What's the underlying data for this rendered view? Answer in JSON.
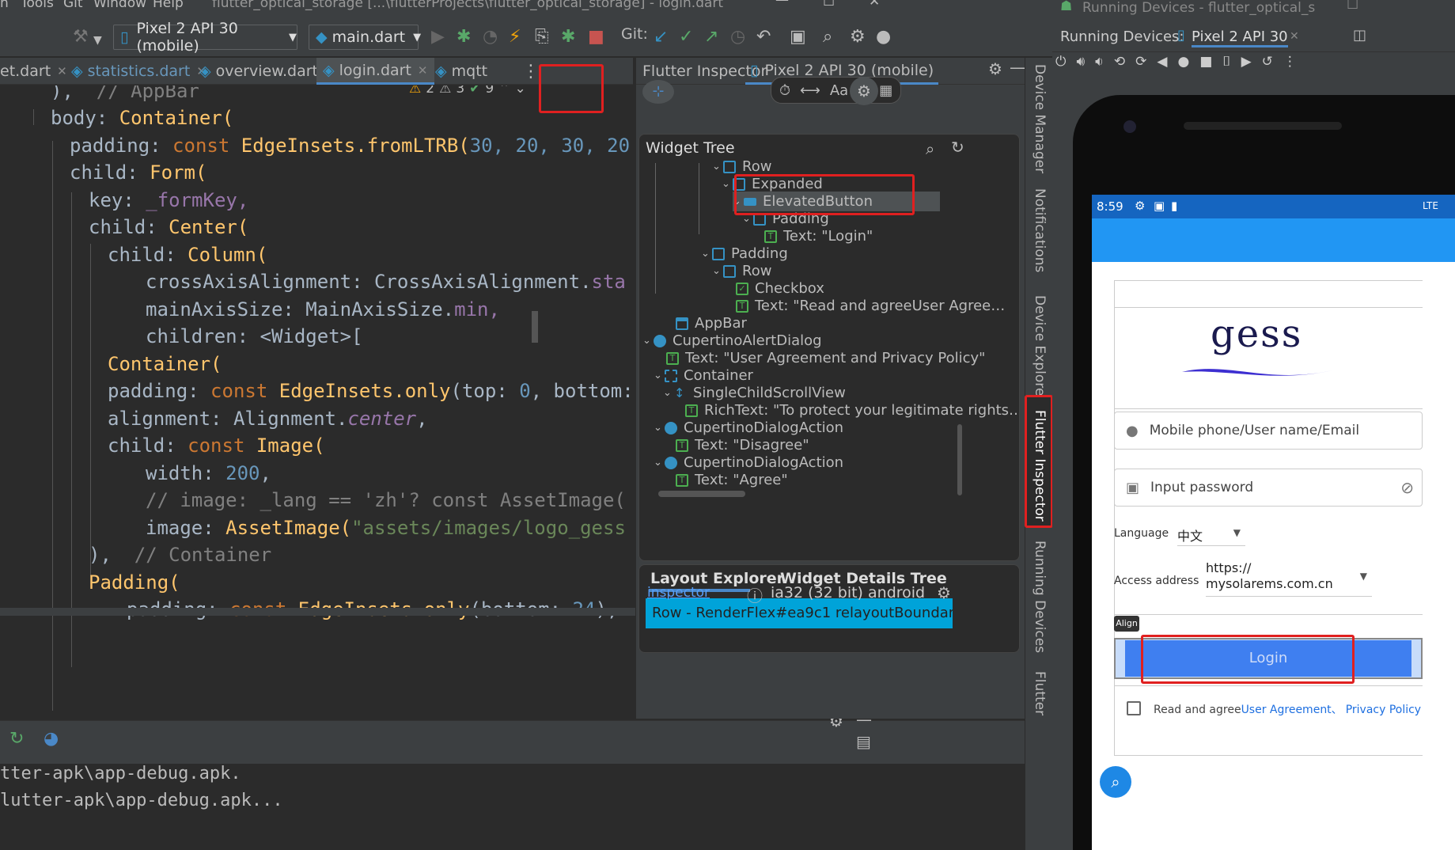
{
  "menu": {
    "items": [
      "n",
      "Tools",
      "Git",
      "Window",
      "Help"
    ],
    "title": "flutter_optical_storage [...\\flutterProjects\\flutter_optical_storage] - login.dart"
  },
  "toolbar": {
    "device": "Pixel 2 API 30 (mobile)",
    "config": "main.dart",
    "git": "Git:"
  },
  "tabs": [
    "et.dart",
    "statistics.dart",
    "overview.dart",
    "login.dart",
    "mqtt"
  ],
  "editor": {
    "warnings": {
      "w1": "2",
      "w2": "3",
      "ok": "9"
    },
    "lines": [
      [
        "),  ",
        "// AppBar"
      ],
      [
        "body: ",
        "Container("
      ],
      [
        "padding: ",
        "const ",
        "EdgeInsets.fromLTRB(",
        "30, 20, 30, 20"
      ],
      [
        "child: ",
        "Form("
      ],
      [
        "key: ",
        "_formKey,"
      ],
      [
        "child: ",
        "Center("
      ],
      [
        "child: ",
        "Column("
      ],
      [
        "crossAxisAlignment: CrossAxisAlignment.",
        "sta"
      ],
      [
        "mainAxisSize: MainAxisSize.",
        "min,"
      ],
      [
        "children: <Widget>["
      ],
      [
        "Container("
      ],
      [
        "padding: ",
        "const ",
        "EdgeInsets.only",
        "(top: ",
        "0",
        ", bottom:"
      ],
      [
        "alignment: Alignment.",
        "center",
        ","
      ],
      [
        "child: ",
        "const ",
        "Image("
      ],
      [
        "width: ",
        "200",
        ","
      ],
      [
        "// image: _lang == 'zh'? const AssetImage("
      ],
      [
        "image: ",
        "AssetImage(",
        "\"assets/images/logo_gess"
      ],
      [
        "),  ",
        "// Container"
      ],
      [
        "Padding("
      ],
      [
        "padding: ",
        "const ",
        "EdgeInsets.only",
        "(bottom: ",
        "24",
        "),"
      ]
    ]
  },
  "inspector": {
    "tab_inspector": "Flutter Inspector",
    "tab_device": "Pixel 2 API 30 (mobile)",
    "tree_title": "Widget Tree",
    "nodes": [
      "Row",
      "Expanded",
      "ElevatedButton",
      "Padding",
      "Text: \"Login\"",
      "Padding",
      "Row",
      "Checkbox",
      "Text: \"Read and agreeUser Agree…",
      "AppBar",
      "CupertinoAlertDialog",
      "Text: \"User Agreement and Privacy Policy\"",
      "Container",
      "SingleChildScrollView",
      "RichText: \"To protect your legitimate rights…",
      "CupertinoDialogAction",
      "Text: \"Disagree\"",
      "CupertinoDialogAction",
      "Text: \"Agree\""
    ],
    "layout_tab": "Layout Explorer",
    "details_tab": "Widget Details Tree",
    "render_row": "Row - RenderFlex#ea9c1 relayoutBoundary…",
    "footer_link": "inspector",
    "footer_info": "ia32 (32 bit) android"
  },
  "side_strip": {
    "device_manager": "Device Manager",
    "notifications": "Notifications",
    "device_explorer": "Device Explorer",
    "flutter_inspector": "Flutter Inspector",
    "running_devices": "Running Devices",
    "flutter": "Flutter"
  },
  "bottom": {
    "lines": [
      "tter-apk\\app-debug.apk.",
      "lutter-apk\\app-debug.apk..."
    ]
  },
  "running": {
    "title": "Running Devices - flutter_optical_s",
    "label": "Running Devices:",
    "device_tab": "Pixel 2 API 30"
  },
  "phone": {
    "time": "8:59",
    "net": "LTE",
    "logo": "gess",
    "username_placeholder": "Mobile phone/User name/Email",
    "password_placeholder": "Input password",
    "language_label": "Language",
    "language_value": "中文",
    "access_label": "Access address",
    "access_value1": "https://",
    "access_value2": "mysolarems.com.cn",
    "align_tip": "Align",
    "login_label": "Login",
    "agree_prefix": "Read and agree",
    "agree_link1": "User Agreement、",
    "agree_link2": "Privacy Policy"
  }
}
